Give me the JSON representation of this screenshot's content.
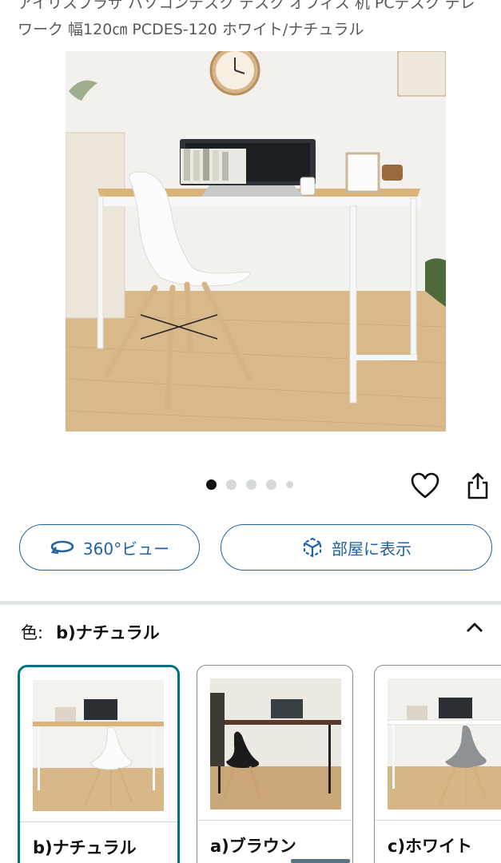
{
  "product": {
    "title": "アイリスプラザ パソコンデスク デスク オフィス 机 PCデスク テレワーク 幅120㎝ PCDES-120 ホワイト/ナチュラル"
  },
  "gallery": {
    "dot_count": 5,
    "active_index": 0
  },
  "actions": {
    "heart_icon": "heart-outline-icon",
    "share_icon": "share-icon"
  },
  "buttons": {
    "view360_label": "360°ビュー",
    "room_label": "部屋に表示"
  },
  "variation": {
    "label": "色:",
    "selected_value": "b)ナチュラル",
    "options": [
      {
        "label": "b)ナチュラル",
        "selected": true
      },
      {
        "label": "a)ブラウン",
        "selected": false
      },
      {
        "label": "c)ホワイト",
        "selected": false
      }
    ]
  },
  "colors": {
    "link_blue": "#2162a1",
    "selected_border": "#007185",
    "text": "#0f1111"
  }
}
